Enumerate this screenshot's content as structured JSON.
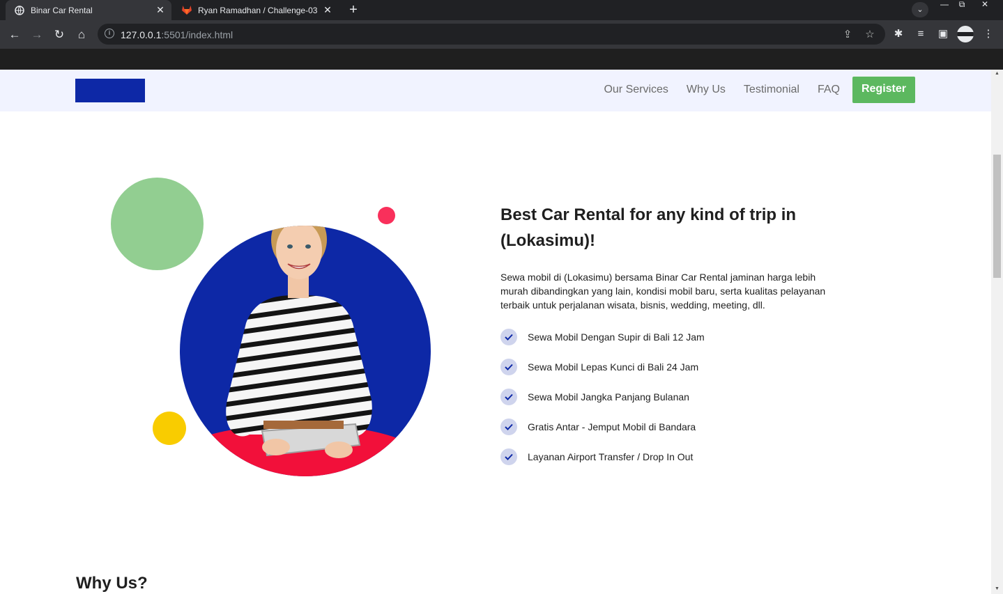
{
  "browser": {
    "tabs": [
      {
        "title": "Binar Car Rental",
        "close": "✕"
      },
      {
        "title": "Ryan Ramadhan / Challenge-03 ·",
        "close": "✕"
      }
    ],
    "new_tab": "+",
    "url_host": "127.0.0.1",
    "url_rest": ":5501/index.html"
  },
  "navbar": {
    "links": [
      "Our Services",
      "Why Us",
      "Testimonial",
      "FAQ"
    ],
    "register": "Register"
  },
  "colors": {
    "brand_blue": "#0d28a6",
    "green": "#5cb85f",
    "nav_bg": "#f1f3ff"
  },
  "hero": {
    "title": "Best Car Rental for any kind of trip in (Lokasimu)!",
    "description": "Sewa mobil di (Lokasimu) bersama Binar Car Rental jaminan harga lebih murah dibandingkan yang lain, kondisi mobil baru, serta kualitas pelayanan terbaik untuk perjalanan wisata, bisnis, wedding, meeting, dll.",
    "checklist": [
      "Sewa Mobil Dengan Supir di Bali 12 Jam",
      "Sewa Mobil Lepas Kunci di Bali 24 Jam",
      "Sewa Mobil Jangka Panjang Bulanan",
      "Gratis Antar - Jemput Mobil di Bandara",
      "Layanan Airport Transfer / Drop In Out"
    ]
  },
  "why_us": {
    "title": "Why Us?"
  }
}
